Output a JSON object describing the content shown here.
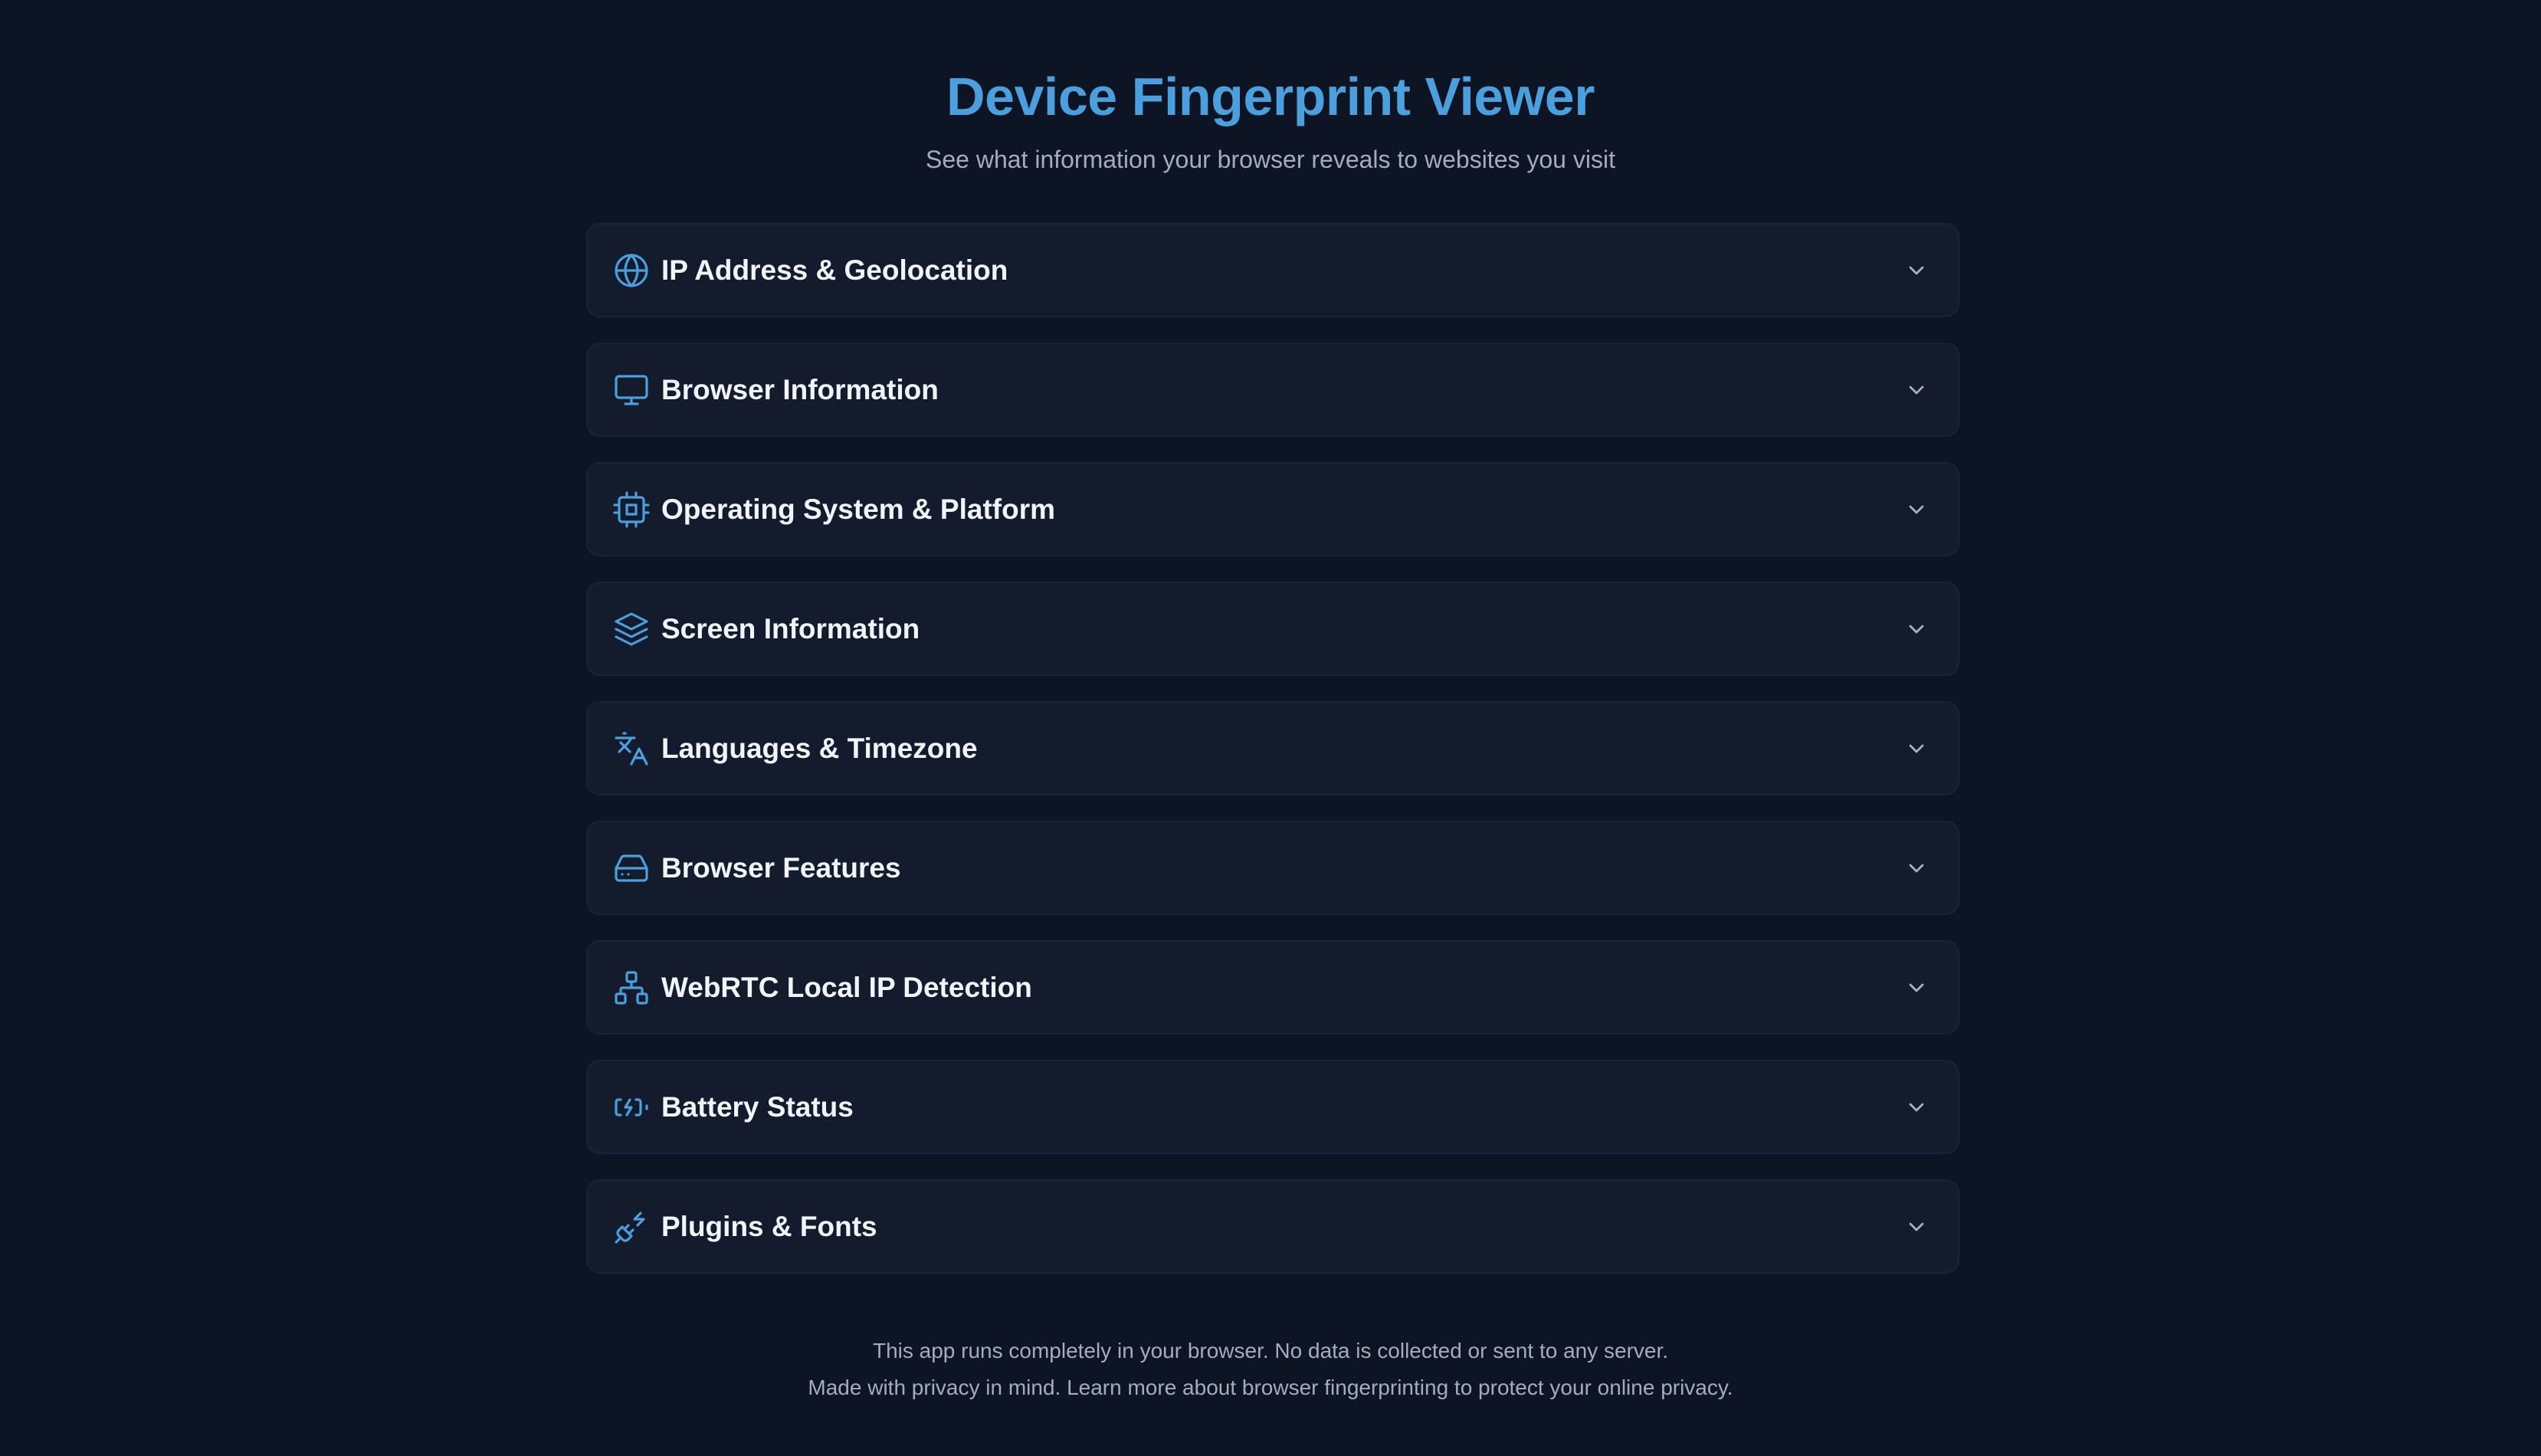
{
  "header": {
    "title": "Device Fingerprint Viewer",
    "subtitle": "See what information your browser reveals to websites you visit"
  },
  "sections": [
    {
      "label": "IP Address & Geolocation",
      "icon": "globe-icon"
    },
    {
      "label": "Browser Information",
      "icon": "monitor-icon"
    },
    {
      "label": "Operating System & Platform",
      "icon": "cpu-icon"
    },
    {
      "label": "Screen Information",
      "icon": "layers-icon"
    },
    {
      "label": "Languages & Timezone",
      "icon": "translate-icon"
    },
    {
      "label": "Browser Features",
      "icon": "hard-drive-icon"
    },
    {
      "label": "WebRTC Local IP Detection",
      "icon": "network-icon"
    },
    {
      "label": "Battery Status",
      "icon": "battery-charging-icon"
    },
    {
      "label": "Plugins & Fonts",
      "icon": "plug-icon"
    }
  ],
  "footer": {
    "line1": "This app runs completely in your browser. No data is collected or sent to any server.",
    "line2": "Made with privacy in mind. Learn more about browser fingerprinting to protect your online privacy."
  },
  "colors": {
    "background": "#0d1525",
    "card": "#131b2d",
    "accent": "#4a9fdc",
    "text": "#f1f4f8",
    "muted": "#a3adbd"
  }
}
